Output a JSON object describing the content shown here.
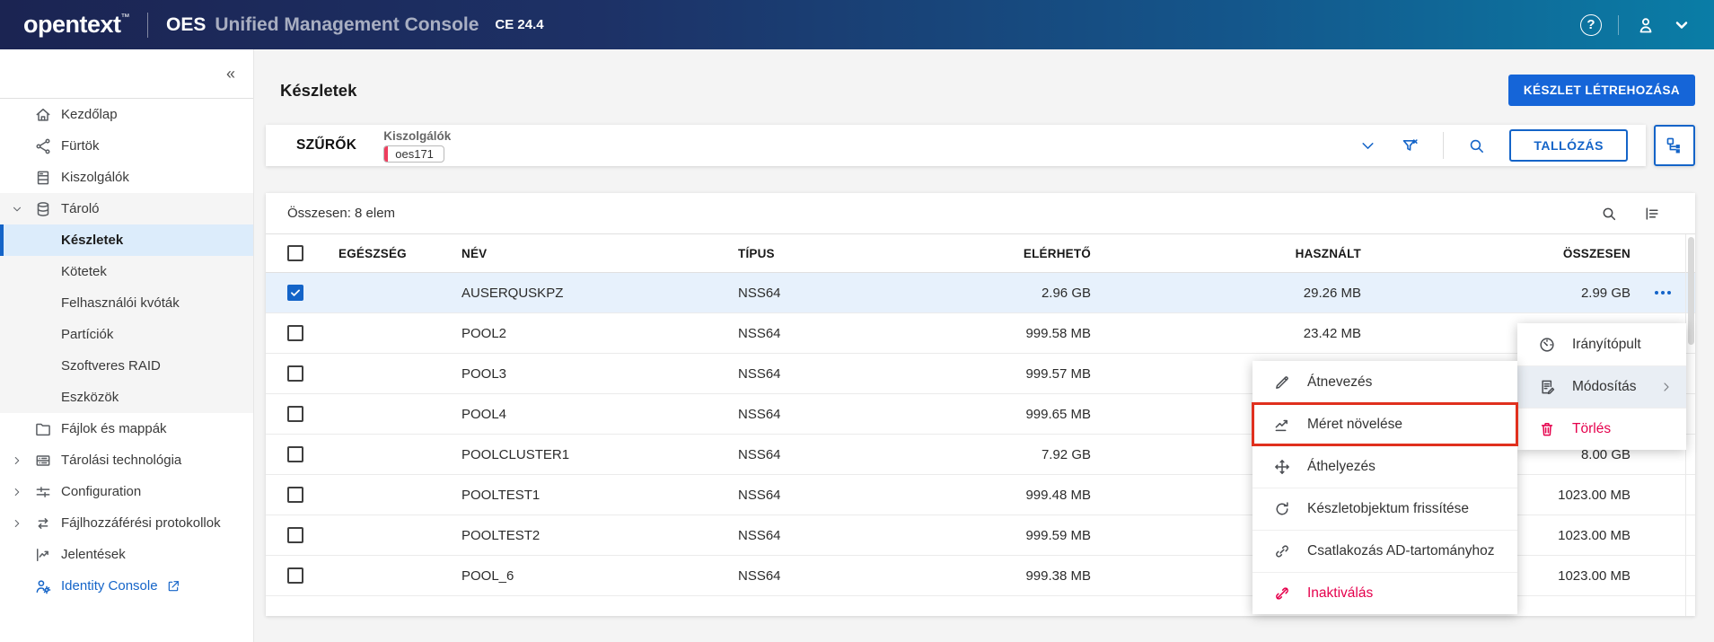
{
  "topbar": {
    "logo": "opentext",
    "trademark": "™",
    "product": "OES",
    "product_name": "Unified Management Console",
    "version": "CE 24.4"
  },
  "sidebar": {
    "collapse_icon": "«",
    "items": [
      {
        "id": "kezdolap",
        "label": "Kezdőlap",
        "icon": "home-icon"
      },
      {
        "id": "furtok",
        "label": "Fürtök",
        "icon": "cluster-icon"
      },
      {
        "id": "kiszolgalok",
        "label": "Kiszolgálók",
        "icon": "servers-icon"
      },
      {
        "id": "tarolo",
        "label": "Tároló",
        "icon": "storage-icon",
        "chevron": "down",
        "group": true
      },
      {
        "id": "keszletek",
        "label": "Készletek",
        "child": true,
        "selected": true,
        "group": true
      },
      {
        "id": "kotetek",
        "label": "Kötetek",
        "child": true,
        "group": true
      },
      {
        "id": "felhasznaloi-kvotak",
        "label": "Felhasználói kvóták",
        "child": true,
        "group": true
      },
      {
        "id": "particiok",
        "label": "Partíciók",
        "child": true,
        "group": true
      },
      {
        "id": "szoftveres-raid",
        "label": "Szoftveres RAID",
        "child": true,
        "group": true
      },
      {
        "id": "eszkozok",
        "label": "Eszközök",
        "child": true,
        "group": true
      },
      {
        "id": "fajlok-es-mappak",
        "label": "Fájlok és mappák",
        "icon": "folder-icon"
      },
      {
        "id": "tarolasi-technologia",
        "label": "Tárolási technológia",
        "icon": "rack-icon",
        "chevron": "right"
      },
      {
        "id": "configuration",
        "label": "Configuration",
        "icon": "tune-icon",
        "chevron": "right"
      },
      {
        "id": "fajlhozzaferesi-protokollok",
        "label": "Fájlhozzáférési protokollok",
        "icon": "protocols-icon",
        "chevron": "right"
      },
      {
        "id": "jelentesek",
        "label": "Jelentések",
        "icon": "reports-icon"
      },
      {
        "id": "identity-console",
        "label": "Identity Console",
        "icon": "identity-icon",
        "external": true
      }
    ]
  },
  "page": {
    "title": "Készletek",
    "create_button": "KÉSZLET LÉTREHOZÁSA"
  },
  "filterbar": {
    "label": "SZŰRŐK",
    "field_label": "Kiszolgálók",
    "chip": "oes171",
    "browse_button": "TALLÓZÁS",
    "icons": [
      "chevron-down-icon",
      "clear-filter-icon",
      "search-icon",
      "tree-icon"
    ]
  },
  "table": {
    "summary": "Összesen: 8 elem",
    "toolbar_icons": [
      "search-icon",
      "list-icon"
    ],
    "columns": [
      "EGÉSZSÉG",
      "NÉV",
      "TÍPUS",
      "ELÉRHETŐ",
      "HASZNÁLT",
      "ÖSSZESEN"
    ],
    "rows": [
      {
        "name": "AUSERQUSKPZ",
        "type": "NSS64",
        "available": "2.96 GB",
        "used": "29.26 MB",
        "total": "2.99 GB",
        "checked": true,
        "selected": true,
        "menu": true
      },
      {
        "name": "POOL2",
        "type": "NSS64",
        "available": "999.58 MB",
        "used": "23.42 MB",
        "total": "",
        "checked": false
      },
      {
        "name": "POOL3",
        "type": "NSS64",
        "available": "999.57 MB",
        "used": "",
        "total": "",
        "checked": false
      },
      {
        "name": "POOL4",
        "type": "NSS64",
        "available": "999.65 MB",
        "used": "",
        "total": "",
        "checked": false
      },
      {
        "name": "POOLCLUSTER1",
        "type": "NSS64",
        "available": "7.92 GB",
        "used": "",
        "total": "8.00 GB",
        "checked": false
      },
      {
        "name": "POOLTEST1",
        "type": "NSS64",
        "available": "999.48 MB",
        "used": "",
        "total": "1023.00 MB",
        "checked": false
      },
      {
        "name": "POOLTEST2",
        "type": "NSS64",
        "available": "999.59 MB",
        "used": "",
        "total": "1023.00 MB",
        "checked": false
      },
      {
        "name": "POOL_6",
        "type": "NSS64",
        "available": "999.38 MB",
        "used": "",
        "total": "1023.00 MB",
        "checked": false
      }
    ]
  },
  "context_menu": {
    "items": [
      {
        "label": "Irányítópult",
        "icon": "gauge-icon"
      },
      {
        "label": "Módosítás",
        "icon": "edit-doc-icon",
        "highlighted": true,
        "submenu": true
      },
      {
        "label": "Törlés",
        "icon": "trash-icon",
        "danger": true
      }
    ]
  },
  "submenu": {
    "items": [
      {
        "label": "Átnevezés",
        "icon": "pencil-icon"
      },
      {
        "label": "Méret növelése",
        "icon": "trend-up-icon",
        "annotated": true
      },
      {
        "label": "Áthelyezés",
        "icon": "move-icon"
      },
      {
        "label": "Készletobjektum frissítése",
        "icon": "refresh-icon"
      },
      {
        "label": "Csatlakozás AD-tartományhoz",
        "icon": "link-icon"
      },
      {
        "label": "Inaktiválás",
        "icon": "link-off-icon",
        "danger": true
      }
    ]
  },
  "colors": {
    "accent": "#1464c8",
    "danger": "#e5004c",
    "health_ok": "#00a651",
    "annotation_red": "#e0301e",
    "selected_row": "#e7f1fc",
    "header_gradient_start": "#1b2452",
    "header_gradient_end": "#0a7da6"
  }
}
